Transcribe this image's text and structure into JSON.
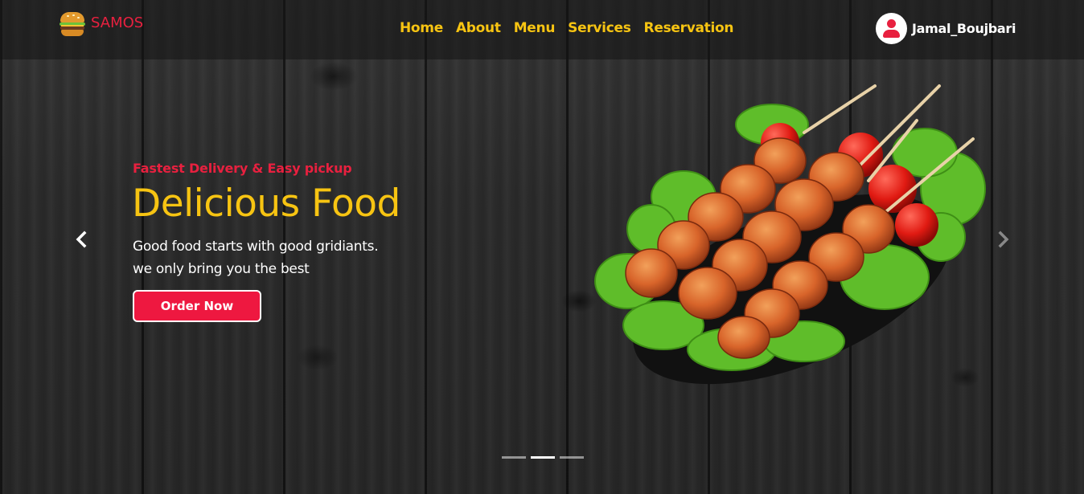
{
  "brand": {
    "name": "SAMOS",
    "icon": "burger-icon"
  },
  "nav": {
    "links": [
      "Home",
      "About",
      "Menu",
      "Services",
      "Reservation"
    ]
  },
  "user": {
    "name": "Jamal_Boujbari",
    "icon": "user-avatar-icon"
  },
  "hero": {
    "subtitle": "Fastest Delivery & Easy pickup",
    "headline": "Delicious Food",
    "description_line1": "Good food starts with good gridiants.",
    "description_line2": "we only bring you the best",
    "cta_label": "Order Now",
    "image": "kebab-skewers-plate-image"
  },
  "carousel": {
    "prev_icon": "chevron-left-icon",
    "next_icon": "chevron-right-icon",
    "slide_count": 3,
    "active_slide": 2
  },
  "colors": {
    "accent_red": "#e8203f",
    "accent_yellow": "#f7c412",
    "button_red": "#ee1840"
  }
}
